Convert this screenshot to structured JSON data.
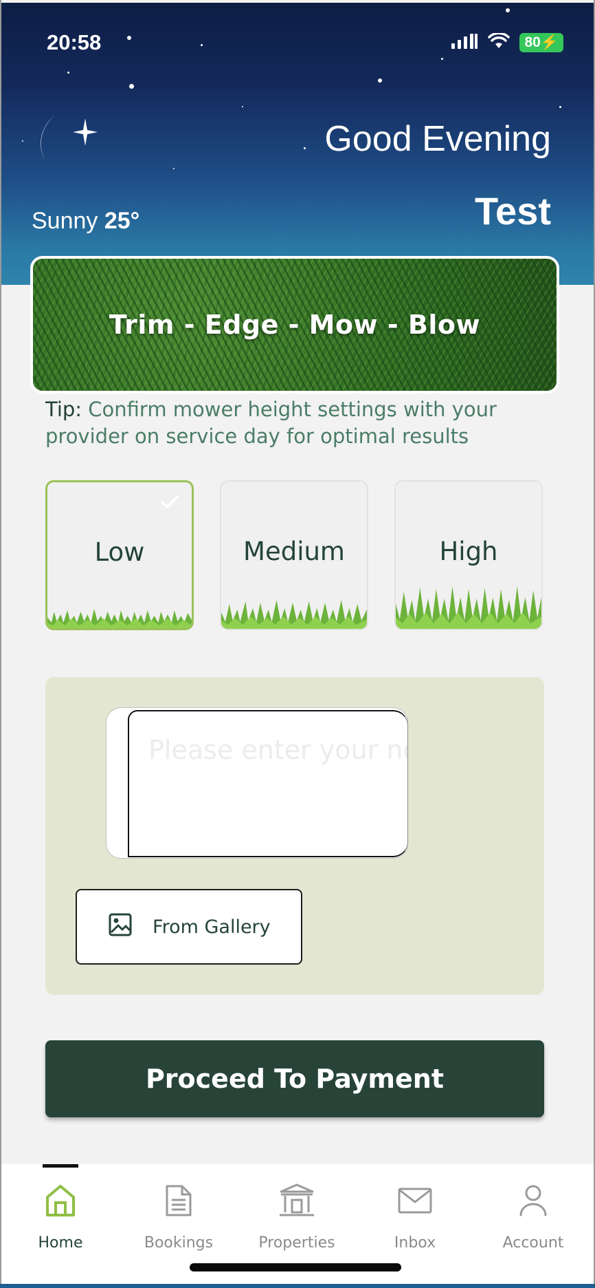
{
  "status_bar": {
    "time": "20:58",
    "battery": "80",
    "icons": [
      "signal-icon",
      "wifi-icon",
      "battery-charging-icon"
    ]
  },
  "header": {
    "weather_label": "Sunny",
    "temperature": "25°",
    "greeting": "Good Evening",
    "user_name": "Test",
    "icon": "moon-icon"
  },
  "banner": {
    "text": "Trim - Edge - Mow - Blow"
  },
  "tip": {
    "label": "Tip:",
    "text": "Confirm mower height settings with your provider on service day for optimal results"
  },
  "height_options": [
    {
      "label": "Low",
      "selected": true
    },
    {
      "label": "Medium",
      "selected": false
    },
    {
      "label": "High",
      "selected": false
    }
  ],
  "notes": {
    "placeholder": "Please enter your notes",
    "value": ""
  },
  "gallery_button": {
    "label": "From Gallery",
    "icon": "image-icon"
  },
  "payment_button": {
    "label": "Proceed To Payment"
  },
  "nav": {
    "items": [
      {
        "label": "Home",
        "icon": "home-icon",
        "active": true
      },
      {
        "label": "Bookings",
        "icon": "document-icon",
        "active": false
      },
      {
        "label": "Properties",
        "icon": "building-icon",
        "active": false
      },
      {
        "label": "Inbox",
        "icon": "mail-icon",
        "active": false
      },
      {
        "label": "Account",
        "icon": "user-icon",
        "active": false
      }
    ]
  },
  "colors": {
    "accent_green": "#9cc159",
    "dark_green": "#284439",
    "panel_bg": "#e3e7d2",
    "sky_top": "#0d1d44",
    "sky_bottom": "#2f84ac"
  }
}
